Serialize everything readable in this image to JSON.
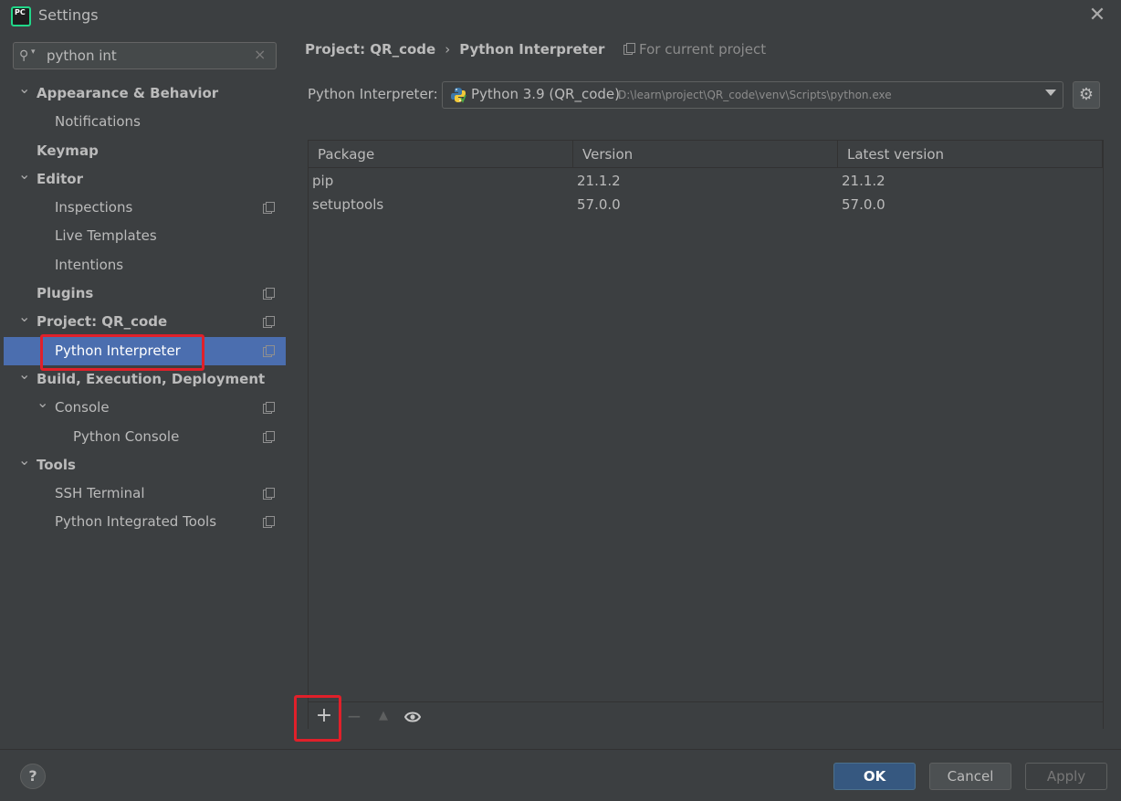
{
  "window": {
    "title": "Settings",
    "close_glyph": "✕"
  },
  "search": {
    "value": "python int",
    "clear_glyph": "×"
  },
  "sidebar": {
    "items": [
      {
        "label": "Appearance & Behavior",
        "level": 0,
        "bold": true,
        "expanded": true
      },
      {
        "label": "Notifications",
        "level": 1
      },
      {
        "label": "Keymap",
        "level": 0,
        "bold": true
      },
      {
        "label": "Editor",
        "level": 0,
        "bold": true,
        "expanded": true
      },
      {
        "label": "Inspections",
        "level": 1,
        "project_icon": true
      },
      {
        "label": "Live Templates",
        "level": 1
      },
      {
        "label": "Intentions",
        "level": 1
      },
      {
        "label": "Plugins",
        "level": 0,
        "bold": true,
        "project_icon": true
      },
      {
        "label": "Project: QR_code",
        "level": 0,
        "bold": true,
        "expanded": true,
        "project_icon": true
      },
      {
        "label": "Python Interpreter",
        "level": 1,
        "selected": true,
        "project_icon": true
      },
      {
        "label": "Build, Execution, Deployment",
        "level": 0,
        "bold": true,
        "expanded": true
      },
      {
        "label": "Console",
        "level": 1,
        "expanded": true,
        "project_icon": true
      },
      {
        "label": "Python Console",
        "level": 2,
        "project_icon": true
      },
      {
        "label": "Tools",
        "level": 0,
        "bold": true,
        "expanded": true
      },
      {
        "label": "SSH Terminal",
        "level": 1,
        "project_icon": true
      },
      {
        "label": "Python Integrated Tools",
        "level": 1,
        "project_icon": true
      }
    ]
  },
  "breadcrumb": {
    "parent": "Project: QR_code",
    "separator": "›",
    "current": "Python Interpreter",
    "scope": "For current project"
  },
  "interpreter": {
    "label": "Python Interpreter:",
    "name": "Python 3.9 (QR_code)",
    "path": "D:\\learn\\project\\QR_code\\venv\\Scripts\\python.exe"
  },
  "packages": {
    "columns": [
      "Package",
      "Version",
      "Latest version"
    ],
    "rows": [
      [
        "pip",
        "21.1.2",
        "21.1.2"
      ],
      [
        "setuptools",
        "57.0.0",
        "57.0.0"
      ]
    ]
  },
  "toolbar": {
    "add": "+",
    "remove": "−",
    "up": "▲",
    "eye": "👁"
  },
  "footer": {
    "help": "?",
    "ok": "OK",
    "cancel": "Cancel",
    "apply": "Apply"
  },
  "colors": {
    "selection": "#4b6eaf",
    "highlight": "#e0202a",
    "ok_button": "#365880"
  }
}
